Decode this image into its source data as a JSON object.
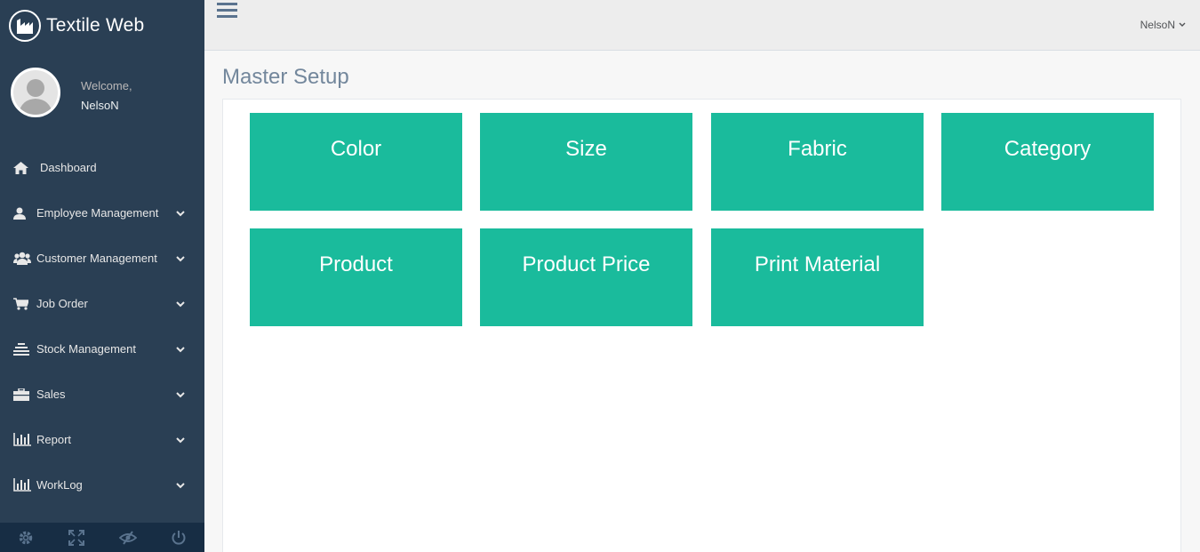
{
  "brand": {
    "title": "Textile Web"
  },
  "profile": {
    "welcome": "Welcome,",
    "name": "NelsoN"
  },
  "menu": [
    {
      "label": "Dashboard",
      "icon": "home-icon"
    },
    {
      "label": "Employee Management",
      "icon": "user-icon"
    },
    {
      "label": "Customer Management",
      "icon": "users-icon"
    },
    {
      "label": "Job Order",
      "icon": "cart-icon"
    },
    {
      "label": "Stock Management",
      "icon": "stack-icon"
    },
    {
      "label": "Sales",
      "icon": "briefcase-icon"
    },
    {
      "label": "Report",
      "icon": "bar-chart-icon"
    },
    {
      "label": "WorkLog",
      "icon": "bar-chart-icon"
    }
  ],
  "footer_icons": [
    "gear-icon",
    "fullscreen-icon",
    "eye-slash-icon",
    "power-icon"
  ],
  "topnav": {
    "user": "NelsoN"
  },
  "page": {
    "title": "Master Setup"
  },
  "tiles": [
    "Color",
    "Size",
    "Fabric",
    "Category",
    "Product",
    "Product Price",
    "Print Material"
  ],
  "colors": {
    "sidebar": "#2a3f54",
    "tile": "#1abb9c",
    "footer": "#172d44"
  }
}
